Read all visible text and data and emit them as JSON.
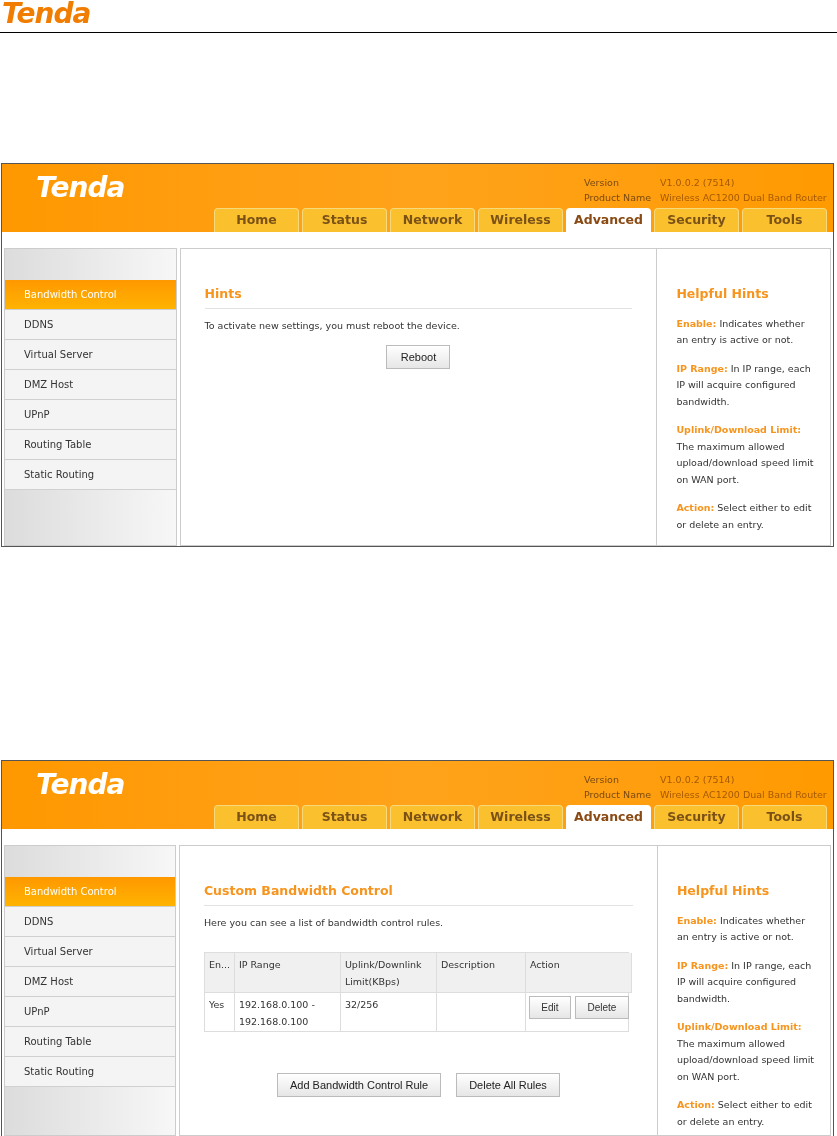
{
  "document_header": {
    "logo": "Tenda"
  },
  "screenshots": [
    {
      "header": {
        "logo": "Tenda",
        "version_label": "Version",
        "version": "V1.0.0.2 (7514)",
        "product_label": "Product Name",
        "product": "Wireless AC1200 Dual Band Router"
      },
      "tabs": [
        {
          "label": "Home",
          "selected": false
        },
        {
          "label": "Status",
          "selected": false
        },
        {
          "label": "Network",
          "selected": false
        },
        {
          "label": "Wireless",
          "selected": false
        },
        {
          "label": "Advanced",
          "selected": true
        },
        {
          "label": "Security",
          "selected": false
        },
        {
          "label": "Tools",
          "selected": false
        }
      ],
      "sidebar": {
        "items": [
          {
            "label": "Bandwidth Control",
            "selected": true
          },
          {
            "label": "DDNS",
            "selected": false
          },
          {
            "label": "Virtual Server",
            "selected": false
          },
          {
            "label": "DMZ Host",
            "selected": false
          },
          {
            "label": "UPnP",
            "selected": false
          },
          {
            "label": "Routing Table",
            "selected": false
          },
          {
            "label": "Static Routing",
            "selected": false
          }
        ]
      },
      "main": {
        "kind": "notice",
        "title": "Hints",
        "text": "To activate new settings, you must reboot the device.",
        "buttons": [
          "Reboot"
        ]
      },
      "helpful_hints": {
        "title": "Helpful Hints",
        "items": [
          {
            "term": "Enable:",
            "text": "Indicates whether an entry is active or not."
          },
          {
            "term": "IP Range:",
            "text": "In IP range, each IP will acquire configured bandwidth."
          },
          {
            "term": "Uplink/Download Limit:",
            "text": "The maximum allowed upload/download speed limit on WAN port."
          },
          {
            "term": "Action:",
            "text": "Select either to edit or delete an entry."
          }
        ]
      }
    },
    {
      "header": {
        "logo": "Tenda",
        "version_label": "Version",
        "version": "V1.0.0.2 (7514)",
        "product_label": "Product Name",
        "product": "Wireless AC1200 Dual Band Router"
      },
      "tabs": [
        {
          "label": "Home",
          "selected": false
        },
        {
          "label": "Status",
          "selected": false
        },
        {
          "label": "Network",
          "selected": false
        },
        {
          "label": "Wireless",
          "selected": false
        },
        {
          "label": "Advanced",
          "selected": true
        },
        {
          "label": "Security",
          "selected": false
        },
        {
          "label": "Tools",
          "selected": false
        }
      ],
      "sidebar": {
        "items": [
          {
            "label": "Bandwidth Control",
            "selected": true
          },
          {
            "label": "DDNS",
            "selected": false
          },
          {
            "label": "Virtual Server",
            "selected": false
          },
          {
            "label": "DMZ Host",
            "selected": false
          },
          {
            "label": "UPnP",
            "selected": false
          },
          {
            "label": "Routing Table",
            "selected": false
          },
          {
            "label": "Static Routing",
            "selected": false
          }
        ]
      },
      "main": {
        "kind": "table",
        "title": "Custom Bandwidth Control",
        "text": "Here you can see a list of bandwidth control rules.",
        "table": {
          "columns": [
            "En...",
            "IP Range",
            "Uplink/Downlink Limit(KBps)",
            "Description",
            "Action"
          ],
          "rows": [
            {
              "enabled": "Yes",
              "ip_range": "192.168.0.100 - 192.168.0.100",
              "limit": "32/256",
              "actions": [
                "Edit",
                "Delete"
              ]
            }
          ]
        },
        "buttons": [
          "Add Bandwidth Control Rule",
          "Delete All Rules"
        ]
      },
      "helpful_hints": {
        "title": "Helpful Hints",
        "items": [
          {
            "term": "Enable:",
            "text": "Indicates whether an entry is active or not."
          },
          {
            "term": "IP Range:",
            "text": "In IP range, each IP will acquire configured bandwidth."
          },
          {
            "term": "Uplink/Download Limit:",
            "text": "The maximum allowed upload/download speed limit on WAN port."
          },
          {
            "term": "Action:",
            "text": "Select either to edit or delete an entry."
          }
        ]
      }
    }
  ]
}
